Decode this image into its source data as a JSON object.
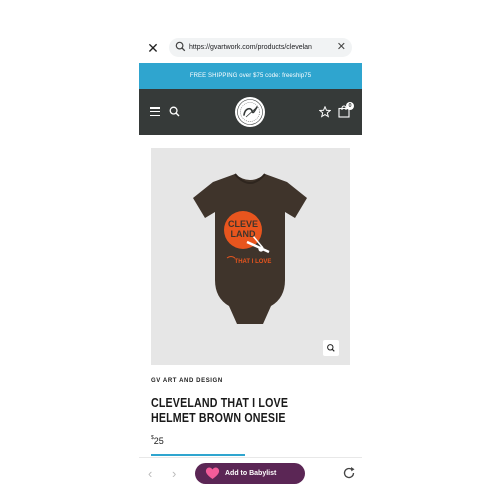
{
  "browser": {
    "url": "https://gvartwork.com/products/clevelan"
  },
  "promo": {
    "text": "FREE SHIPPING over $75 code: freeship75"
  },
  "header": {
    "cart_count": "0"
  },
  "product": {
    "image": {
      "shirt_text_line1": "CLEVE",
      "shirt_text_line2": "LAND",
      "shirt_text_line3": "THAT I LOVE",
      "shirt_color": "#3f342b",
      "print_color": "#e8551e"
    },
    "vendor": "GV ART AND DESIGN",
    "title": "CLEVELAND THAT I LOVE HELMET BROWN ONESIE",
    "price_currency": "$",
    "price_amount": "25"
  },
  "bottom_bar": {
    "babylist_label": "Add to Babylist"
  },
  "colors": {
    "promo_bg": "#2fa5cf",
    "header_bg": "#363a39",
    "babylist_bg": "#5b2655",
    "heart": "#f25c9a"
  }
}
